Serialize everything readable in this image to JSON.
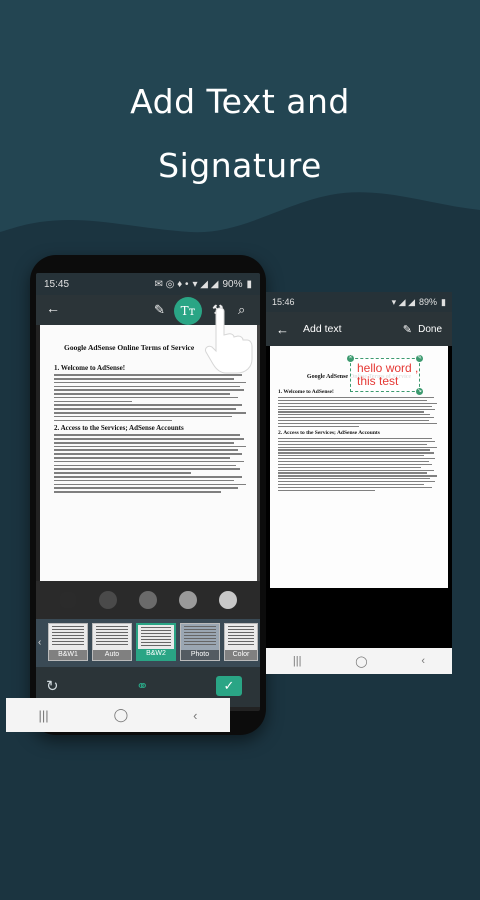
{
  "headline": {
    "line1": "Add Text and",
    "line2": "Signature"
  },
  "colors": {
    "background": "#1b3440",
    "wave": "#234552",
    "accent": "#2aa585",
    "text_color": "#e53935"
  },
  "left_phone": {
    "status": {
      "time": "15:45",
      "battery": "90%"
    },
    "toolbar": {
      "back": "←",
      "text_tool": "Tт",
      "icons": [
        "back-arrow-icon",
        "pen-icon",
        "text-icon",
        "magic-wand-icon",
        "zoom-icon"
      ]
    },
    "document": {
      "title": "Google AdSense Online Terms of Service",
      "sections": [
        "1.  Welcome to AdSense!",
        "2.  Access to the Services; AdSense Accounts"
      ]
    },
    "swatches": [
      "#2b2b2b",
      "#4a4a4a",
      "#6a6a6a",
      "#9a9a9a",
      "#c8c8c8"
    ],
    "filters": [
      {
        "label": "B&W1",
        "selected": false
      },
      {
        "label": "Auto",
        "selected": false
      },
      {
        "label": "B&W2",
        "selected": true
      },
      {
        "label": "Photo",
        "selected": false
      },
      {
        "label": "Color",
        "selected": false
      }
    ],
    "actions": {
      "rotate": "↻",
      "confirm": "✓"
    },
    "nav": {
      "recent": "|||",
      "home": "◯",
      "back": "‹"
    }
  },
  "right_phone": {
    "status": {
      "time": "15:46",
      "battery": "89%"
    },
    "toolbar": {
      "back": "←",
      "title": "Add text",
      "done": "Done"
    },
    "document": {
      "title": "Google AdSense Online Terms of Service",
      "sections": [
        "1.  Welcome to AdSense!",
        "2.  Access to the Services; AdSense Accounts"
      ]
    },
    "text_box": {
      "line1": "hello word ,",
      "line2": "this test"
    },
    "nav": {
      "recent": "|||",
      "home": "◯",
      "back": "‹"
    }
  }
}
